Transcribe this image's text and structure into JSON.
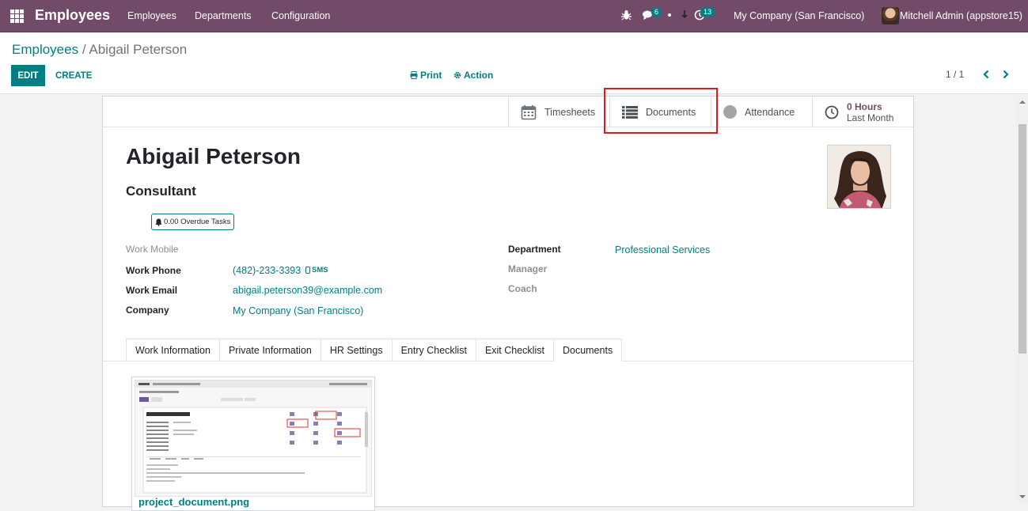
{
  "navbar": {
    "app_name": "Employees",
    "menu": [
      "Employees",
      "Departments",
      "Configuration"
    ],
    "messages_count": "6",
    "activities_count": "13",
    "company": "My Company (San Francisco)",
    "user": "Mitchell Admin (appstore15)"
  },
  "control_panel": {
    "breadcrumb_parent": "Employees",
    "breadcrumb_separator": "/",
    "breadcrumb_current": "Abigail Peterson",
    "edit_label": "EDIT",
    "create_label": "CREATE",
    "print_label": "Print",
    "action_label": "Action",
    "pager": "1 / 1"
  },
  "smart_buttons": {
    "timesheets": "Timesheets",
    "documents": "Documents",
    "attendance": "Attendance",
    "hours_value": "0 Hours",
    "hours_period": "Last Month"
  },
  "employee": {
    "name": "Abigail Peterson",
    "job_title": "Consultant",
    "overdue_tasks": "0.00 Overdue Tasks",
    "work_mobile_label": "Work Mobile",
    "work_phone_label": "Work Phone",
    "work_phone": "(482)-233-3393",
    "sms_label": "SMS",
    "work_email_label": "Work Email",
    "work_email": "abigail.peterson39@example.com",
    "company_label": "Company",
    "company": "My Company (San Francisco)",
    "department_label": "Department",
    "department": "Professional Services",
    "manager_label": "Manager",
    "coach_label": "Coach"
  },
  "tabs": [
    "Work Information",
    "Private Information",
    "HR Settings",
    "Entry Checklist",
    "Exit Checklist",
    "Documents"
  ],
  "active_tab": "Documents",
  "documents": [
    {
      "file_name": "project_document.png"
    }
  ],
  "colors": {
    "navbar": "#714b67",
    "primary": "#017e84",
    "highlight": "#dc1c1c"
  }
}
